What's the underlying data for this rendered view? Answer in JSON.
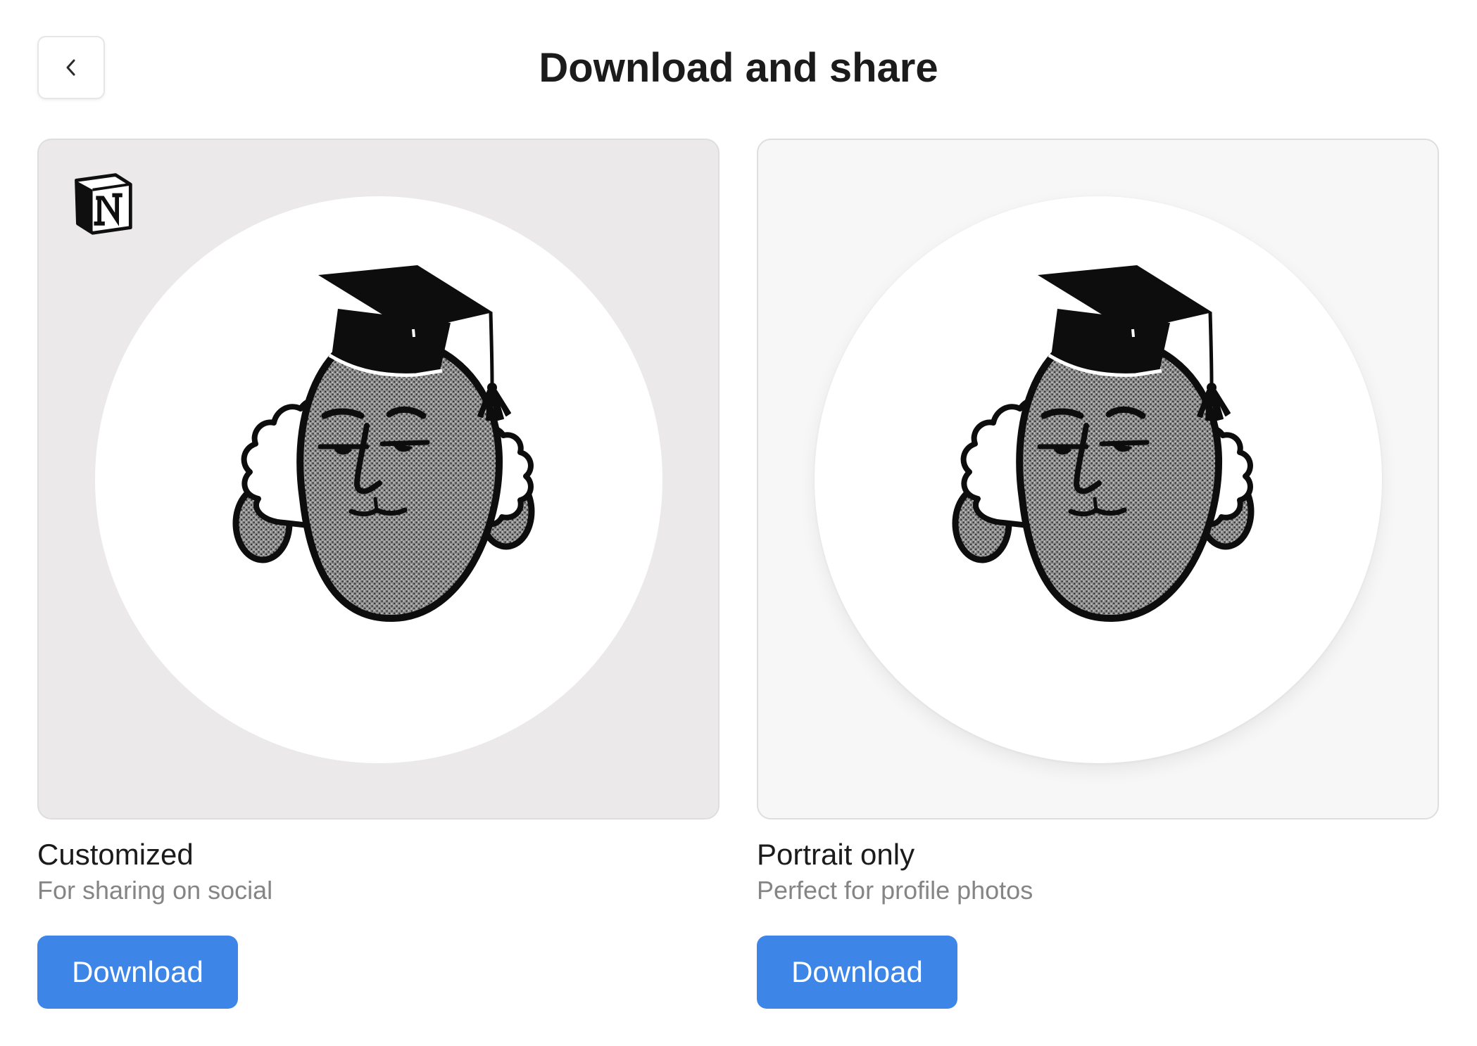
{
  "header": {
    "title": "Download and share",
    "back_icon": "chevron-left-icon"
  },
  "options": [
    {
      "title": "Customized",
      "subtitle": "For sharing on social",
      "button_label": "Download",
      "background": "#ebe9ea",
      "badge_letter": "N",
      "badge_icon": "notion-logo-icon"
    },
    {
      "title": "Portrait only",
      "subtitle": "Perfect for profile photos",
      "button_label": "Download",
      "background": "#f7f7f7"
    }
  ],
  "colors": {
    "accent": "#3d86e8",
    "title_text": "#1b1b1b",
    "subtitle_text": "#858585"
  }
}
